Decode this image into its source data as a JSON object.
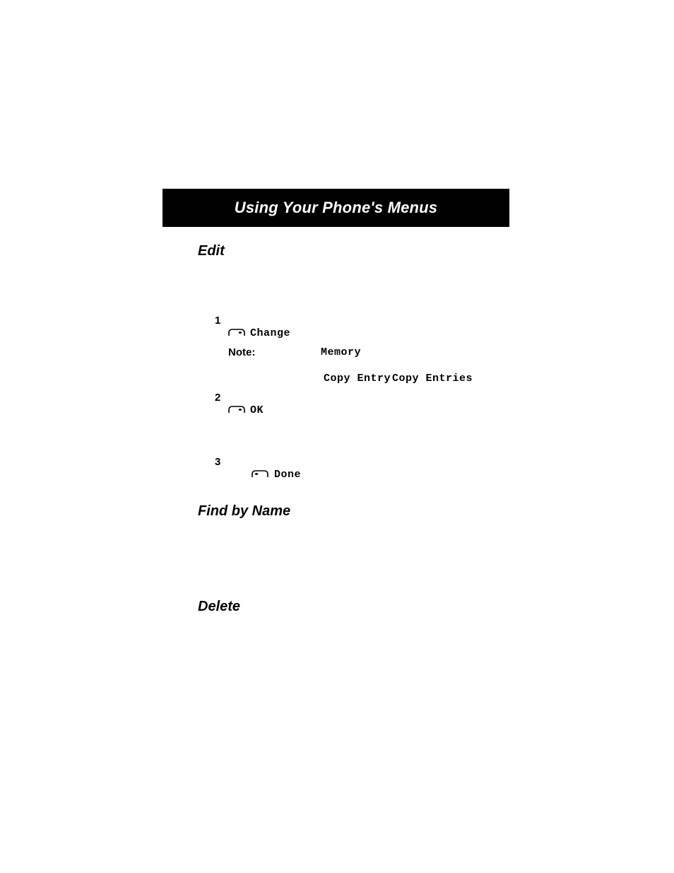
{
  "banner": {
    "title": "Using Your Phone's Menus"
  },
  "sections": {
    "edit": {
      "heading": "Edit"
    },
    "find": {
      "heading": "Find by Name"
    },
    "delete": {
      "heading": "Delete"
    }
  },
  "steps": {
    "s1": {
      "num": "1",
      "softkey": "Change",
      "note_label": "Note:",
      "memory": "Memory",
      "copy_entry": "Copy Entry",
      "copy_entries": "Copy Entries"
    },
    "s2": {
      "num": "2",
      "softkey": "OK"
    },
    "s3": {
      "num": "3",
      "softkey": "Done"
    }
  }
}
